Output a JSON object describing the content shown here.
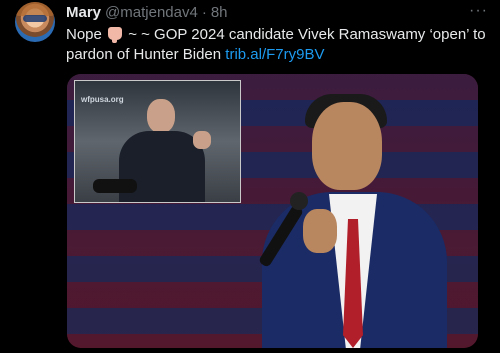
{
  "tweet": {
    "author_name": "Mary",
    "author_handle": "@matjendav4",
    "separator": "·",
    "time": "8h",
    "more": "···",
    "text_part1": "Nope",
    "text_part2": "~ ~ GOP 2024 candidate Vivek Ramaswamy ‘open’ to pardon of Hunter Biden",
    "link": "trib.al/F7ry9BV"
  },
  "media": {
    "inset_logo": "wfpusa.org"
  },
  "icons": {
    "thumbs_down": "thumbs-down-icon"
  },
  "colors": {
    "background": "#000000",
    "text": "#e7e9ea",
    "muted": "#71767b",
    "link": "#1d9bf0"
  }
}
